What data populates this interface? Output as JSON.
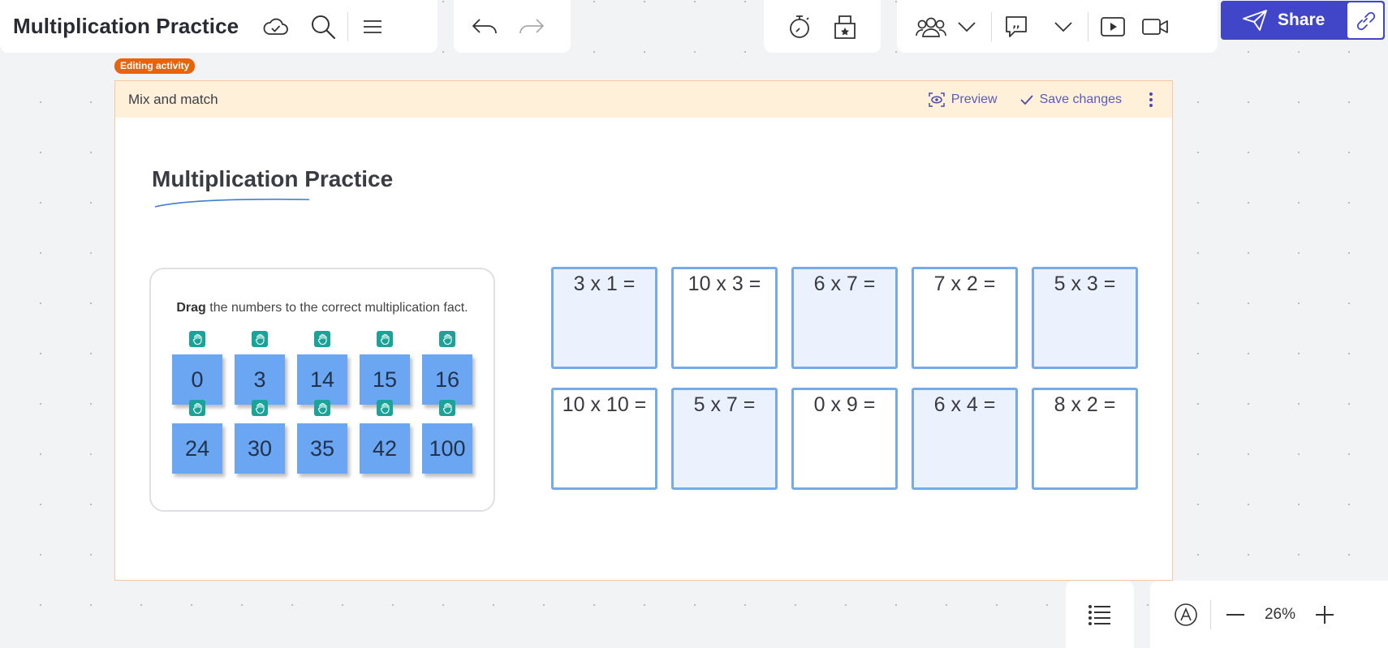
{
  "app": {
    "title": "Multiplication Practice"
  },
  "toolbar": {
    "share_label": "Share",
    "zoom": "26%"
  },
  "editing_badge": "Editing activity",
  "activity": {
    "type_label": "Mix and match",
    "preview_label": "Preview",
    "save_label": "Save changes",
    "title": "Multiplication Practice",
    "instruction_bold": "Drag",
    "instruction_rest": " the numbers to the correct multiplication fact.",
    "tiles": [
      "0",
      "3",
      "14",
      "15",
      "16",
      "24",
      "30",
      "35",
      "42",
      "100"
    ],
    "facts": [
      "3 x 1 =",
      "10 x 3 =",
      "6 x 7 =",
      "7 x 2 =",
      "5 x 3 =",
      "10 x 10 =",
      "5 x 7 =",
      "0 x 9 =",
      "6 x 4 =",
      "8 x 2 ="
    ]
  },
  "colors": {
    "accent": "#4145c8",
    "badge": "#e8630a",
    "tile": "#6aa6f2",
    "grip": "#1aa398",
    "fact_border": "#75abea",
    "bar_bg": "#fff1d9"
  },
  "icons": [
    "cloud-check-icon",
    "search-icon",
    "menu-icon",
    "undo-icon",
    "redo-icon",
    "timer-icon",
    "vote-box-icon",
    "participants-icon",
    "chevron-down-icon",
    "comment-icon",
    "present-icon",
    "video-icon",
    "send-icon",
    "link-icon",
    "preview-eye-icon",
    "check-icon",
    "more-vertical-icon",
    "hand-grip-icon",
    "list-icon",
    "accessibility-icon",
    "zoom-out-icon",
    "zoom-in-icon"
  ]
}
